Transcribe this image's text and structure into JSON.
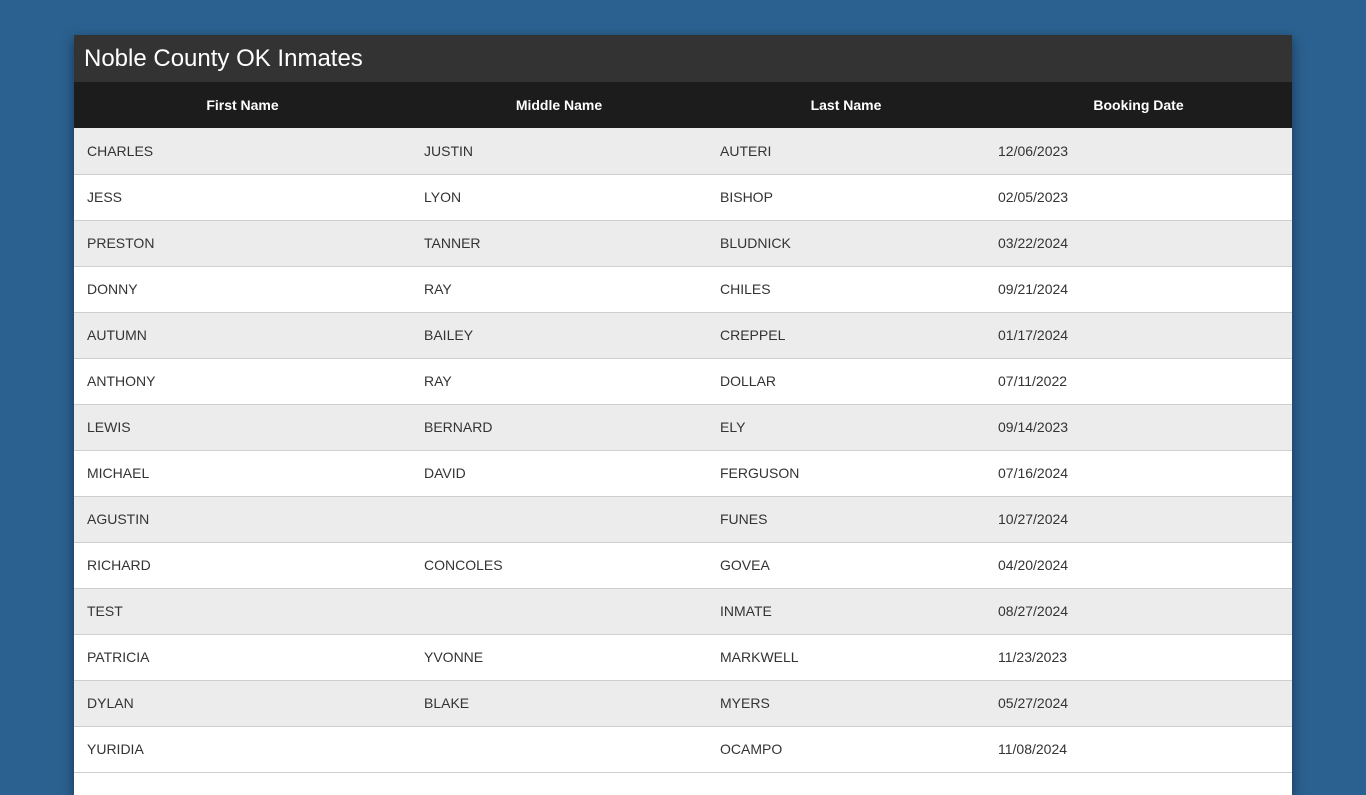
{
  "page": {
    "title": "Noble County OK Inmates"
  },
  "table": {
    "headers": [
      "First Name",
      "Middle Name",
      "Last Name",
      "Booking Date"
    ],
    "rows": [
      [
        "CHARLES",
        "JUSTIN",
        "AUTERI",
        "12/06/2023"
      ],
      [
        "JESS",
        "LYON",
        "BISHOP",
        "02/05/2023"
      ],
      [
        "PRESTON",
        "TANNER",
        "BLUDNICK",
        "03/22/2024"
      ],
      [
        "DONNY",
        "RAY",
        "CHILES",
        "09/21/2024"
      ],
      [
        "AUTUMN",
        "BAILEY",
        "CREPPEL",
        "01/17/2024"
      ],
      [
        "ANTHONY",
        "RAY",
        "DOLLAR",
        "07/11/2022"
      ],
      [
        "LEWIS",
        "BERNARD",
        "ELY",
        "09/14/2023"
      ],
      [
        "MICHAEL",
        "DAVID",
        "FERGUSON",
        "07/16/2024"
      ],
      [
        "AGUSTIN",
        "",
        "FUNES",
        "10/27/2024"
      ],
      [
        "RICHARD",
        "CONCOLES",
        "GOVEA",
        "04/20/2024"
      ],
      [
        "TEST",
        "",
        "INMATE",
        "08/27/2024"
      ],
      [
        "PATRICIA",
        "YVONNE",
        "MARKWELL",
        "11/23/2023"
      ],
      [
        "DYLAN",
        "BLAKE",
        "MYERS",
        "05/27/2024"
      ],
      [
        "YURIDIA",
        "",
        "OCAMPO",
        "11/08/2024"
      ]
    ]
  },
  "colors": {
    "background": "#2b6190",
    "title_bar": "#333333",
    "header_row": "#1c1c1c",
    "row_odd": "#ececec",
    "row_even": "#ffffff"
  }
}
